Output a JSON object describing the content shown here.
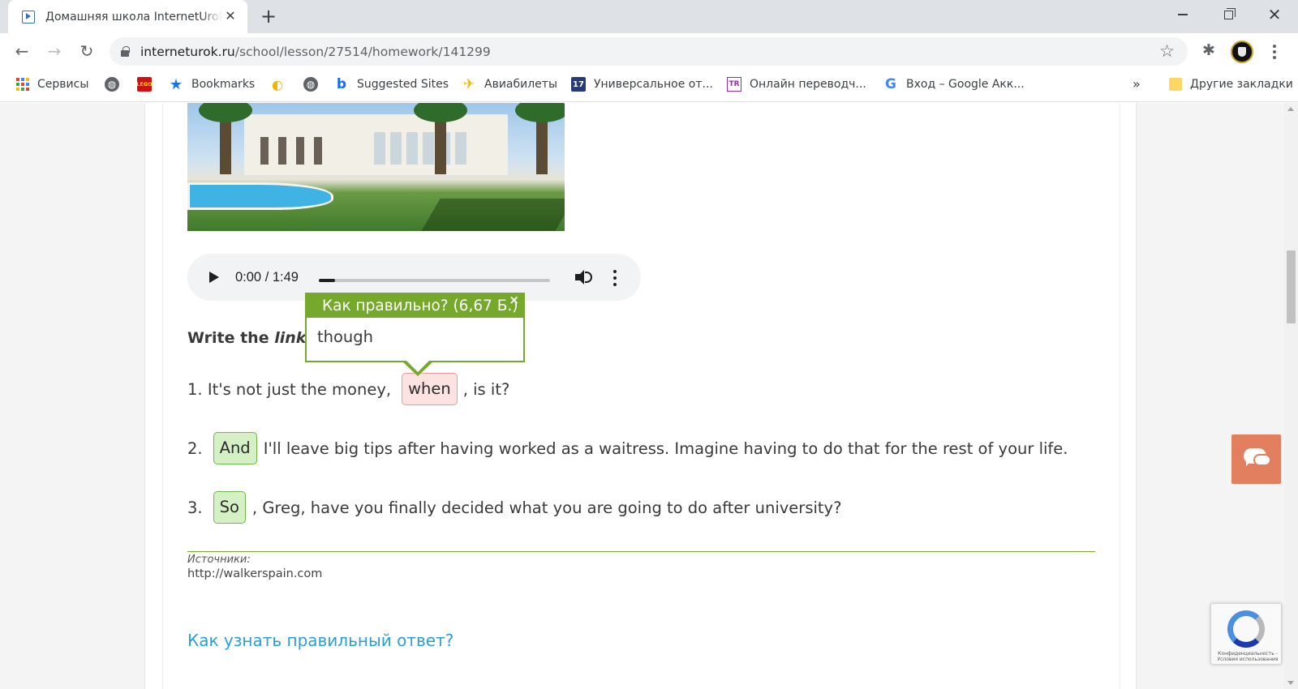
{
  "browser": {
    "tab_title": "Домашняя школа InternetUrok.ru",
    "tab_close": "✕",
    "new_tab": "+",
    "url_host": "interneturok.ru",
    "url_path": "/school/lesson/27514/homework/141299",
    "bookmarks": [
      {
        "label": "Сервисы",
        "icon": "apps-icon"
      },
      {
        "label": "",
        "icon": "globe-icon"
      },
      {
        "label": "",
        "icon": "lego-icon"
      },
      {
        "label": "Bookmarks",
        "icon": "star-icon"
      },
      {
        "label": "",
        "icon": "app-icon"
      },
      {
        "label": "",
        "icon": "globe-icon"
      },
      {
        "label": "Suggested Sites",
        "icon": "bing-icon"
      },
      {
        "label": "Авиабилеты",
        "icon": "plane-icon"
      },
      {
        "label": "Универсальное от...",
        "icon": "17-icon"
      },
      {
        "label": "Онлайн переводч...",
        "icon": "translate-icon"
      },
      {
        "label": "Вход – Google Акк...",
        "icon": "google-icon"
      }
    ],
    "bookmarks_more": "»",
    "other_bookmarks": "Другие закладки"
  },
  "audio": {
    "time": "0:00 / 1:49",
    "progress_fraction": 0.07
  },
  "exercise": {
    "instruction_prefix": "Write the ",
    "instruction_em": "linker",
    "popup": {
      "title": "Как правильно? (6,67 Б.)",
      "close": "×",
      "answer": "though"
    },
    "questions": [
      {
        "num": "1.",
        "before": "It's not just the money,",
        "answer": "when",
        "status": "wrong",
        "after": ", is it?"
      },
      {
        "num": "2.",
        "before": "",
        "answer": "And",
        "status": "right",
        "after": "I'll leave big tips after having worked as a waitress. Imagine having to do that for the rest of your life."
      },
      {
        "num": "3.",
        "before": "",
        "answer": "So",
        "status": "right",
        "after": ", Greg, have you finally decided what you are going to do after university?"
      }
    ]
  },
  "sources": {
    "label": "Источники:",
    "link": "http://walkerspain.com"
  },
  "howto_link": "Как узнать правильный ответ?",
  "recaptcha": {
    "text": "Конфиденциальность - Условия использования"
  },
  "colors": {
    "accent_green": "#76a82b",
    "wrong_bg": "#fde2e2",
    "right_bg": "#d6f0c6",
    "link_blue": "#2a9fd6",
    "chat_orange": "#e27f5e"
  }
}
